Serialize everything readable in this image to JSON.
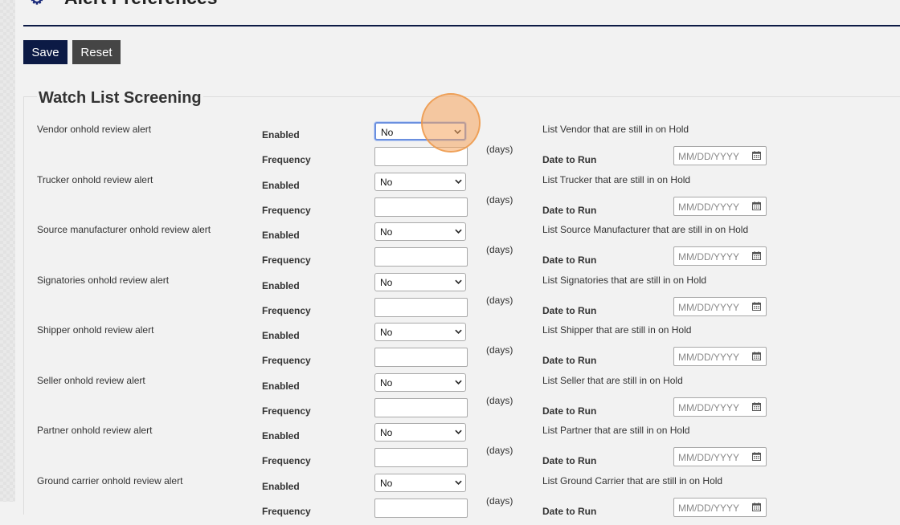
{
  "header": {
    "title": "Alert Preferences",
    "icon": "gear-icon"
  },
  "toolbar": {
    "save_label": "Save",
    "reset_label": "Reset"
  },
  "section": {
    "title": "Watch List Screening",
    "enabled_label": "Enabled",
    "frequency_label": "Frequency",
    "days_label": "(days)",
    "date_label": "Date to Run",
    "date_placeholder": "MM/DD/YYYY",
    "alerts": [
      {
        "name": "Vendor onhold review alert",
        "enabled": "No",
        "frequency": "",
        "description": "List Vendor that are still in on Hold",
        "date": ""
      },
      {
        "name": "Trucker onhold review alert",
        "enabled": "No",
        "frequency": "",
        "description": "List Trucker that are still in on Hold",
        "date": ""
      },
      {
        "name": "Source manufacturer onhold review alert",
        "enabled": "No",
        "frequency": "",
        "description": "List Source Manufacturer that are still in on Hold",
        "date": ""
      },
      {
        "name": "Signatories onhold review alert",
        "enabled": "No",
        "frequency": "",
        "description": "List Signatories that are still in on Hold",
        "date": ""
      },
      {
        "name": "Shipper onhold review alert",
        "enabled": "No",
        "frequency": "",
        "description": "List Shipper that are still in on Hold",
        "date": ""
      },
      {
        "name": "Seller onhold review alert",
        "enabled": "No",
        "frequency": "",
        "description": "List Seller that are still in on Hold",
        "date": ""
      },
      {
        "name": "Partner onhold review alert",
        "enabled": "No",
        "frequency": "",
        "description": "List Partner that are still in on Hold",
        "date": ""
      },
      {
        "name": "Ground carrier onhold review alert",
        "enabled": "No",
        "frequency": "",
        "description": "List Ground Carrier that are still in on Hold",
        "date": ""
      }
    ]
  },
  "colors": {
    "primary": "#0c1a45",
    "secondary_button": "#454545",
    "focus": "#6a8fdf",
    "click_indicator": "#f6a45c"
  }
}
